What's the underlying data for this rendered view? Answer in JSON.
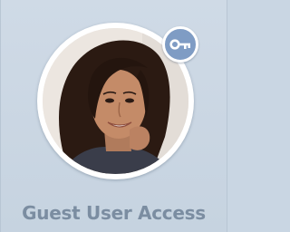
{
  "tile": {
    "title": "Guest User Access",
    "badge_icon": "key-icon",
    "badge_color": "#7f9cc4",
    "title_color": "#7b8da1",
    "background_color": "#c9d6e3"
  },
  "avatar": {
    "subject": "user-photo"
  }
}
